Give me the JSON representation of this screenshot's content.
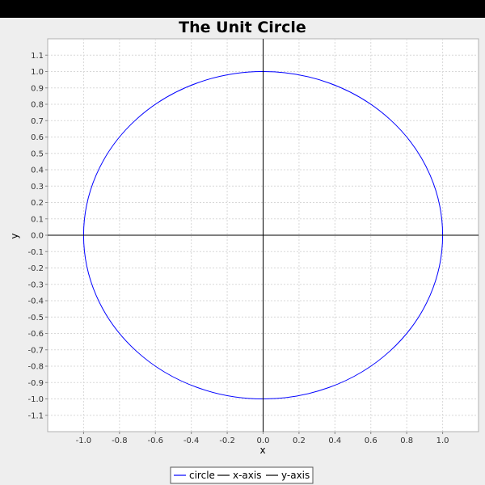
{
  "chart_data": {
    "type": "line",
    "title": "The Unit Circle",
    "xlabel": "x",
    "ylabel": "y",
    "xlim": [
      -1.2,
      1.2
    ],
    "ylim": [
      -1.2,
      1.2
    ],
    "x_ticks": [
      -1.0,
      -0.8,
      -0.6,
      -0.4,
      -0.2,
      0.0,
      0.2,
      0.4,
      0.6,
      0.8,
      1.0
    ],
    "x_tick_labels": [
      "-1.0",
      "-0.8",
      "-0.6",
      "-0.4",
      "-0.2",
      "0.0",
      "0.2",
      "0.4",
      "0.6",
      "0.8",
      "1.0"
    ],
    "y_ticks": [
      1.1,
      1.0,
      0.9,
      0.8,
      0.7,
      0.6,
      0.5,
      0.4,
      0.3,
      0.2,
      0.1,
      0.0,
      -0.1,
      -0.2,
      -0.3,
      -0.4,
      -0.5,
      -0.6,
      -0.7,
      -0.8,
      -0.9,
      -1.0,
      -1.1
    ],
    "y_tick_labels": [
      "1.1",
      "1.0",
      "0.9",
      "0.8",
      "0.7",
      "0.6",
      "0.5",
      "0.4",
      "0.3",
      "0.2",
      "0.1",
      "0.0",
      "-0.1",
      "-0.2",
      "-0.3",
      "-0.4",
      "-0.5",
      "-0.6",
      "-0.7",
      "-0.8",
      "-0.9",
      "-1.0",
      "-1.1"
    ],
    "grid": true,
    "legend_position": "bottom",
    "series": [
      {
        "name": "circle",
        "color": "#0000ff",
        "kind": "circle",
        "center": [
          0,
          0
        ],
        "radius": 1.0
      },
      {
        "name": "x-axis",
        "color": "#000000",
        "points": [
          [
            -1.2,
            0
          ],
          [
            1.2,
            0
          ]
        ]
      },
      {
        "name": "y-axis",
        "color": "#000000",
        "points": [
          [
            0,
            -1.2
          ],
          [
            0,
            1.2
          ]
        ]
      }
    ]
  }
}
